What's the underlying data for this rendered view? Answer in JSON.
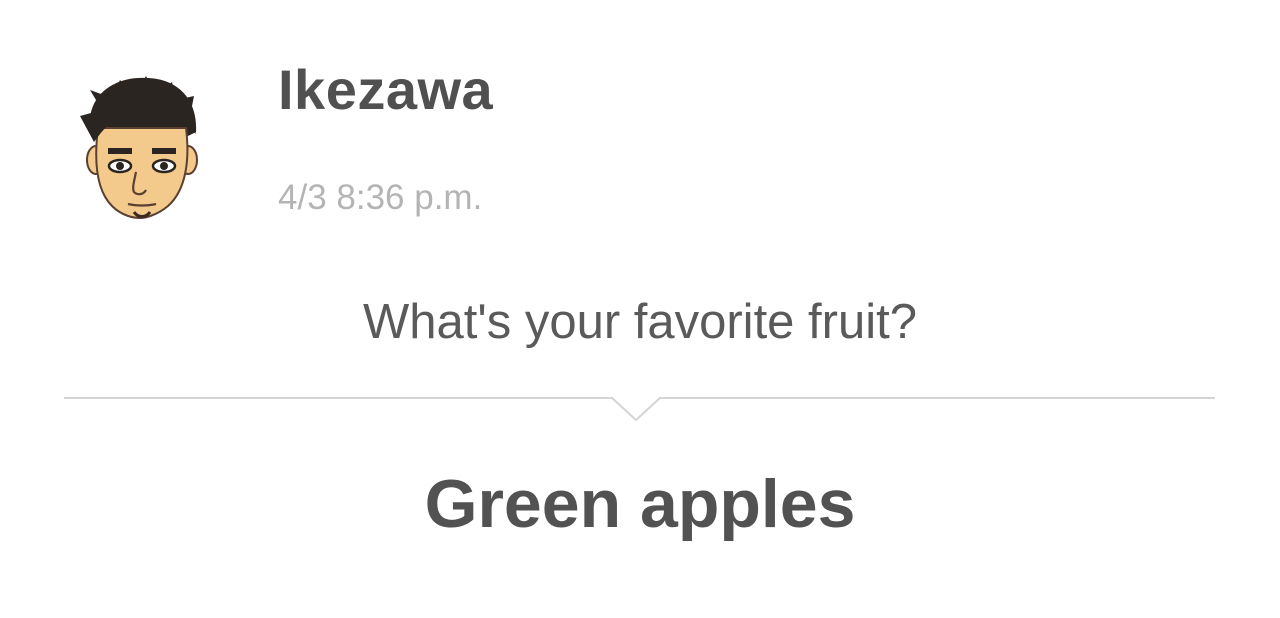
{
  "post": {
    "author": "Ikezawa",
    "timestamp": "4/3 8:36 p.m.",
    "question": "What's your favorite fruit?",
    "answer": "Green apples",
    "avatar_icon": "mii-avatar-icon"
  },
  "colors": {
    "text_primary": "#505050",
    "text_secondary": "#b4b4b4",
    "divider": "#d4d4d4",
    "background": "#ffffff"
  }
}
